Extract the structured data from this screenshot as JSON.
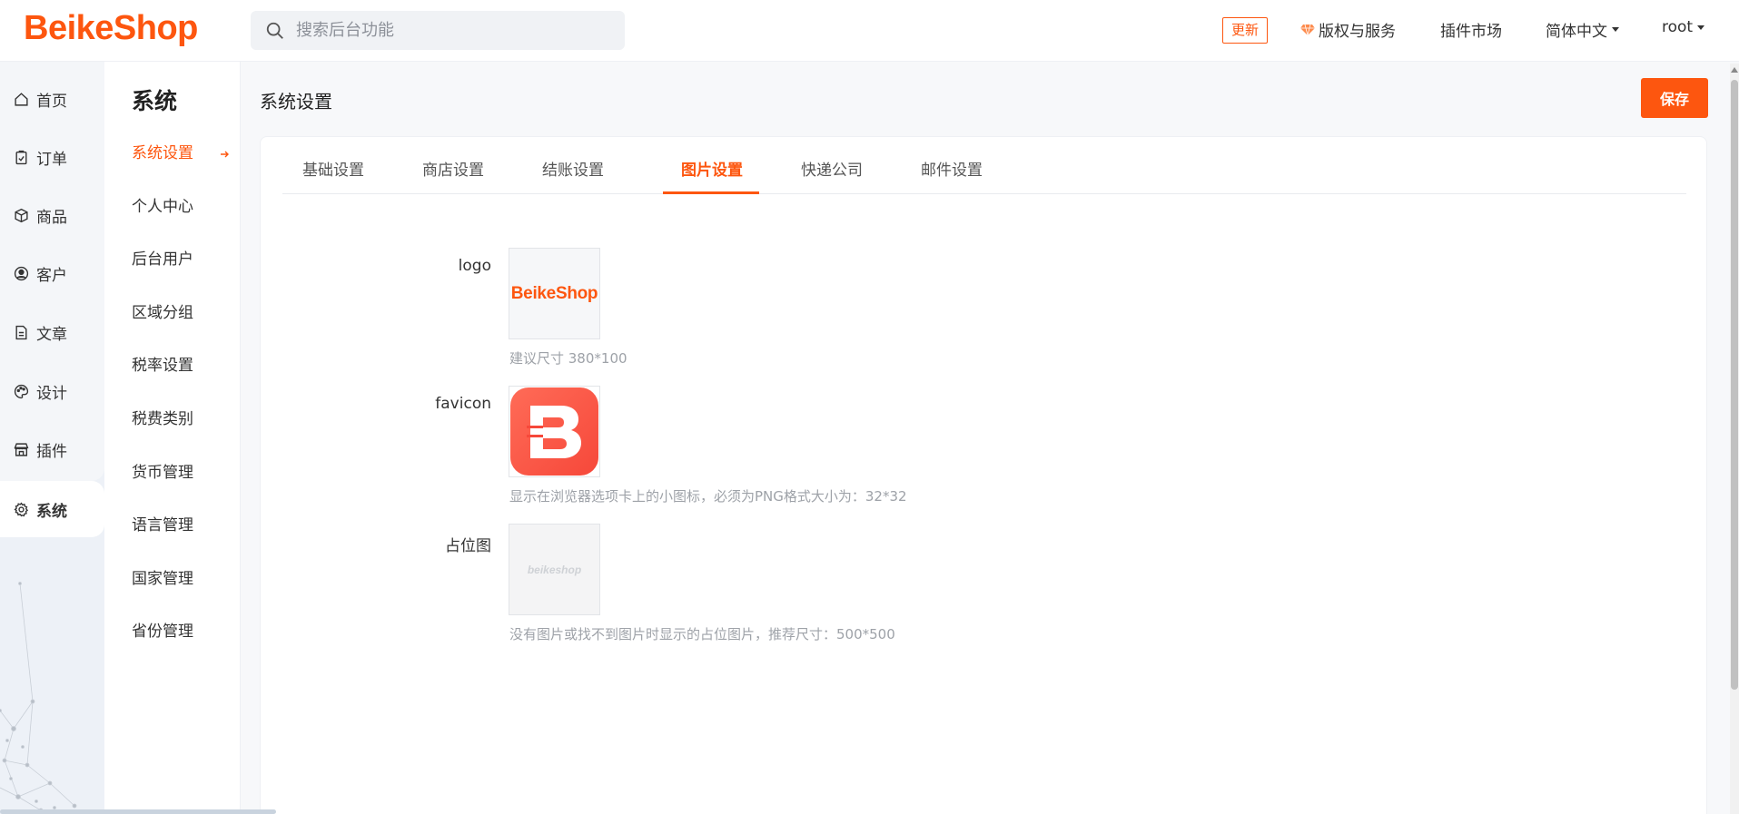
{
  "brand": {
    "name": "BeikeShop"
  },
  "search": {
    "placeholder": "搜索后台功能"
  },
  "header": {
    "update_label": "更新",
    "license_label": "版权与服务",
    "plugin_market_label": "插件市场",
    "language_label": "简体中文",
    "user_label": "root"
  },
  "leftnav": {
    "items": [
      {
        "label": "首页",
        "icon": "home-icon"
      },
      {
        "label": "订单",
        "icon": "clipboard-icon"
      },
      {
        "label": "商品",
        "icon": "box-icon"
      },
      {
        "label": "客户",
        "icon": "user-circle-icon"
      },
      {
        "label": "文章",
        "icon": "document-icon"
      },
      {
        "label": "设计",
        "icon": "palette-icon"
      },
      {
        "label": "插件",
        "icon": "shop-icon"
      },
      {
        "label": "系统",
        "icon": "gear-icon"
      }
    ],
    "active": "系统"
  },
  "subnav": {
    "title": "系统",
    "items": [
      "系统设置",
      "个人中心",
      "后台用户",
      "区域分组",
      "税率设置",
      "税费类别",
      "货币管理",
      "语言管理",
      "国家管理",
      "省份管理"
    ],
    "active": "系统设置"
  },
  "main": {
    "title": "系统设置",
    "save_label": "保存",
    "tabs": [
      "基础设置",
      "商店设置",
      "结账设置",
      "图片设置",
      "快递公司",
      "邮件设置"
    ],
    "active_tab": "图片设置",
    "fields": [
      {
        "label": "logo",
        "image_text": "BeikeShop",
        "hint": "建议尺寸 380*100"
      },
      {
        "label": "favicon",
        "hint": "显示在浏览器选项卡上的小图标，必须为PNG格式大小为：32*32"
      },
      {
        "label": "占位图",
        "image_text": "beikeshop",
        "hint": "没有图片或找不到图片时显示的占位图片，推荐尺寸：500*500"
      }
    ]
  },
  "colors": {
    "accent": "#fd560f",
    "bg": "#f7f8fa"
  }
}
